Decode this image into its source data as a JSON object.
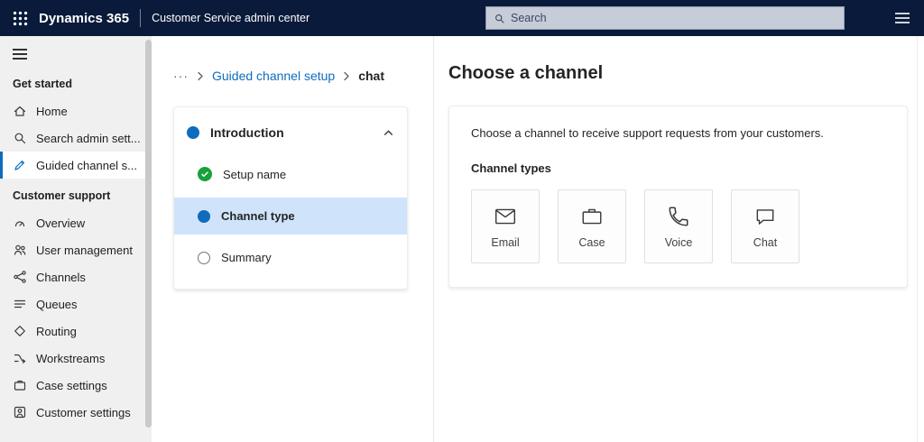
{
  "colors": {
    "topbar-bg": "#0a1a3a",
    "accent": "#0f6cbd",
    "link": "#0f6cbd",
    "step-selected-bg": "#cfe4fa",
    "done-green": "#17a23b",
    "sidebar-bg": "#f0f0f0"
  },
  "topbar": {
    "brand": "Dynamics 365",
    "app_title": "Customer Service admin center",
    "search_placeholder": "Search"
  },
  "sidebar": {
    "sections": [
      {
        "label": "Get started",
        "items": [
          {
            "label": "Home",
            "icon": "home-icon",
            "selected": false
          },
          {
            "label": "Search admin sett...",
            "icon": "search-icon",
            "selected": false
          },
          {
            "label": "Guided channel s...",
            "icon": "guided-channel-setup-icon",
            "selected": true
          }
        ]
      },
      {
        "label": "Customer support",
        "items": [
          {
            "label": "Overview",
            "icon": "overview-icon",
            "selected": false
          },
          {
            "label": "User management",
            "icon": "user-management-icon",
            "selected": false
          },
          {
            "label": "Channels",
            "icon": "channels-icon",
            "selected": false
          },
          {
            "label": "Queues",
            "icon": "queues-icon",
            "selected": false
          },
          {
            "label": "Routing",
            "icon": "routing-icon",
            "selected": false
          },
          {
            "label": "Workstreams",
            "icon": "workstreams-icon",
            "selected": false
          },
          {
            "label": "Case settings",
            "icon": "case-settings-icon",
            "selected": false
          },
          {
            "label": "Customer settings",
            "icon": "customer-settings-icon",
            "selected": false
          }
        ]
      }
    ]
  },
  "breadcrumb": {
    "overflow": "···",
    "parent": "Guided channel setup",
    "current": "chat"
  },
  "wizard": {
    "section_label": "Introduction",
    "steps": [
      {
        "label": "Setup name",
        "state": "completed"
      },
      {
        "label": "Channel type",
        "state": "current"
      },
      {
        "label": "Summary",
        "state": "upcoming"
      }
    ]
  },
  "main": {
    "heading": "Choose a channel",
    "description": "Choose a channel to receive support requests from your customers.",
    "channel_types_label": "Channel types",
    "channel_tiles": [
      {
        "label": "Email",
        "icon": "email-icon"
      },
      {
        "label": "Case",
        "icon": "briefcase-icon"
      },
      {
        "label": "Voice",
        "icon": "phone-icon"
      },
      {
        "label": "Chat",
        "icon": "chat-bubble-icon"
      }
    ]
  }
}
